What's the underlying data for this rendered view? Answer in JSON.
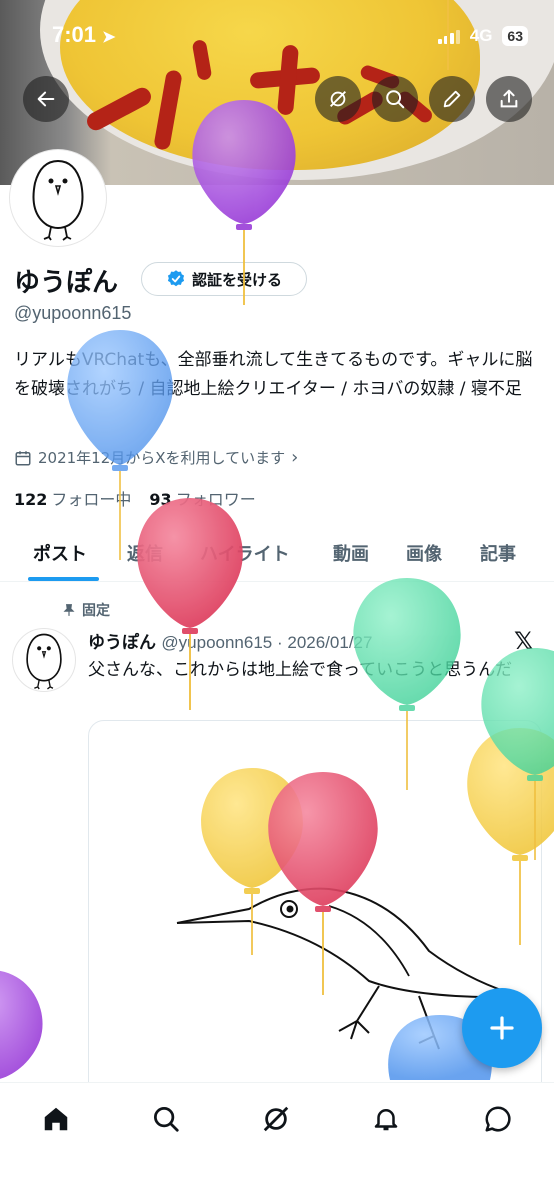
{
  "status_bar": {
    "time": "7:01",
    "network": "4G",
    "battery": "63"
  },
  "profile": {
    "name": "ゆうぽん",
    "verify_button": "認証を受ける",
    "handle": "@yupoonn615",
    "bio": "リアルもVRChatも、全部垂れ流して生きてるものです。ギャルに脳を破壊されがち / 自認地上絵クリエイター / ホヨバの奴隷 / 寝不足",
    "joined": "2021年12月からXを利用しています",
    "following_count": "122",
    "following_label": "フォロー中",
    "followers_count": "93",
    "followers_label": "フォロワー"
  },
  "tabs": [
    "ポスト",
    "返信",
    "ハイライト",
    "動画",
    "画像",
    "記事"
  ],
  "pinned_post": {
    "pinned_label": "固定",
    "author": "ゆうぽん",
    "handle_date": "@yupoonn615 · 2026/01/27",
    "text": "父さんな、これからは地上絵で食っていこうと思うんだ"
  },
  "icons": {
    "back": "back-arrow-icon",
    "grok": "grok-icon",
    "search": "search-icon",
    "edit": "edit-pencil-icon",
    "share": "share-icon",
    "calendar": "calendar-icon",
    "pin": "pin-icon",
    "x_logo": "x-logo-icon",
    "compose": "plus-icon",
    "nav_home": "home-icon",
    "nav_search": "search-icon",
    "nav_grok": "grok-icon",
    "nav_notifications": "bell-icon",
    "nav_messages": "message-icon"
  },
  "colors": {
    "accent": "#1d9bf0",
    "text": "#0f1419",
    "muted": "#536471"
  }
}
